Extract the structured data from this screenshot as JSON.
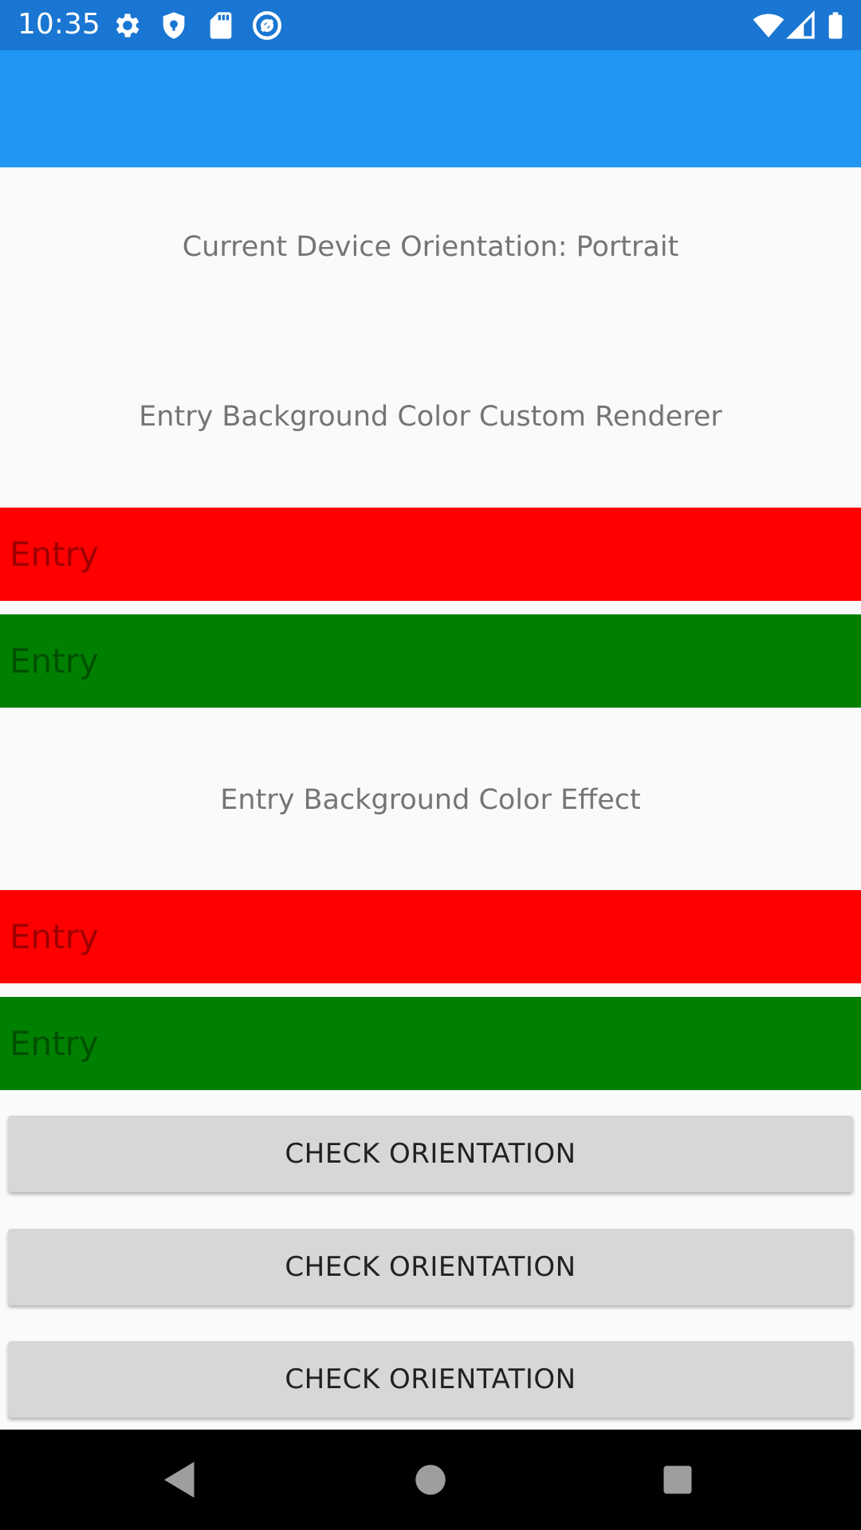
{
  "status_bar": {
    "time": "10:35",
    "icons": [
      "gear-icon",
      "shield-icon",
      "sd-card-icon",
      "at-sign-icon",
      "wifi-icon",
      "signal-icon",
      "battery-icon"
    ],
    "background": "#1976D2"
  },
  "toolbar": {
    "background": "#2196F3"
  },
  "main": {
    "orientation_label": "Current Device Orientation: Portrait",
    "renderer_section_title": "Entry Background Color Custom Renderer",
    "renderer_entries": [
      {
        "placeholder": "Entry",
        "background": "#FF0000"
      },
      {
        "placeholder": "Entry",
        "background": "#008000"
      }
    ],
    "effect_section_title": "Entry Background Color Effect",
    "effect_entries": [
      {
        "placeholder": "Entry",
        "background": "#FF0000"
      },
      {
        "placeholder": "Entry",
        "background": "#008000"
      }
    ],
    "buttons": [
      {
        "label": "CHECK ORIENTATION"
      },
      {
        "label": "CHECK ORIENTATION"
      },
      {
        "label": "CHECK ORIENTATION"
      }
    ]
  },
  "nav_bar": {
    "icons": [
      "back-icon",
      "home-icon",
      "recents-icon"
    ]
  }
}
